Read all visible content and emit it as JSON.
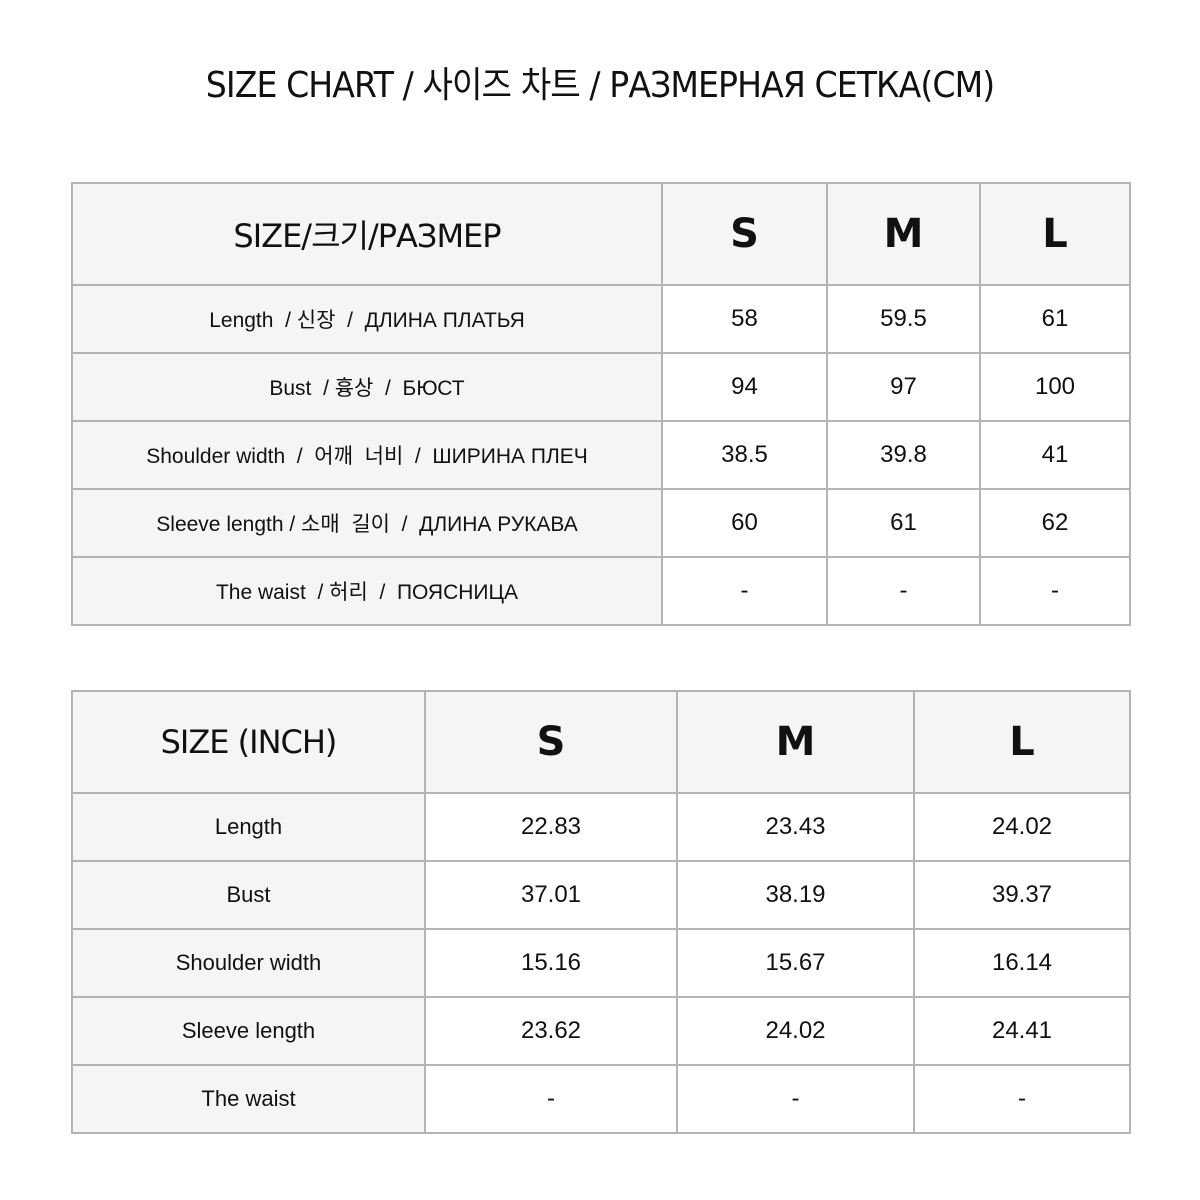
{
  "title": "SIZE CHART / 사이즈 차트 / РАЗМЕРНАЯ СЕТКА(CM)",
  "chart_data": [
    {
      "type": "table",
      "title": "SIZE CHART / 사이즈 차트 / РАЗМЕРНАЯ СЕТКА(CM)",
      "unit": "cm",
      "header_label": "SIZE/크기/РАЗМЕР",
      "columns": [
        "S",
        "M",
        "L"
      ],
      "rows": [
        {
          "label": "Length  / 신장  /  ДЛИНА ПЛАТЬЯ",
          "values": [
            "58",
            "59.5",
            "61"
          ]
        },
        {
          "label": "Bust  / 흉상  /  БЮСТ",
          "values": [
            "94",
            "97",
            "100"
          ]
        },
        {
          "label": "Shoulder width  /  어깨  너비  /  ШИРИНА ПЛЕЧ",
          "values": [
            "38.5",
            "39.8",
            "41"
          ]
        },
        {
          "label": "Sleeve length / 소매  길이  /  ДЛИНА РУКАВА",
          "values": [
            "60",
            "61",
            "62"
          ]
        },
        {
          "label": "The waist  / 허리  /  ПОЯСНИЦА",
          "values": [
            "-",
            "-",
            "-"
          ]
        }
      ]
    },
    {
      "type": "table",
      "unit": "inch",
      "header_label": "SIZE (INCH)",
      "columns": [
        "S",
        "M",
        "L"
      ],
      "rows": [
        {
          "label": "Length",
          "values": [
            "22.83",
            "23.43",
            "24.02"
          ]
        },
        {
          "label": "Bust",
          "values": [
            "37.01",
            "38.19",
            "39.37"
          ]
        },
        {
          "label": "Shoulder width",
          "values": [
            "15.16",
            "15.67",
            "16.14"
          ]
        },
        {
          "label": "Sleeve length",
          "values": [
            "23.62",
            "24.02",
            "24.41"
          ]
        },
        {
          "label": "The waist",
          "values": [
            "-",
            "-",
            "-"
          ]
        }
      ]
    }
  ]
}
